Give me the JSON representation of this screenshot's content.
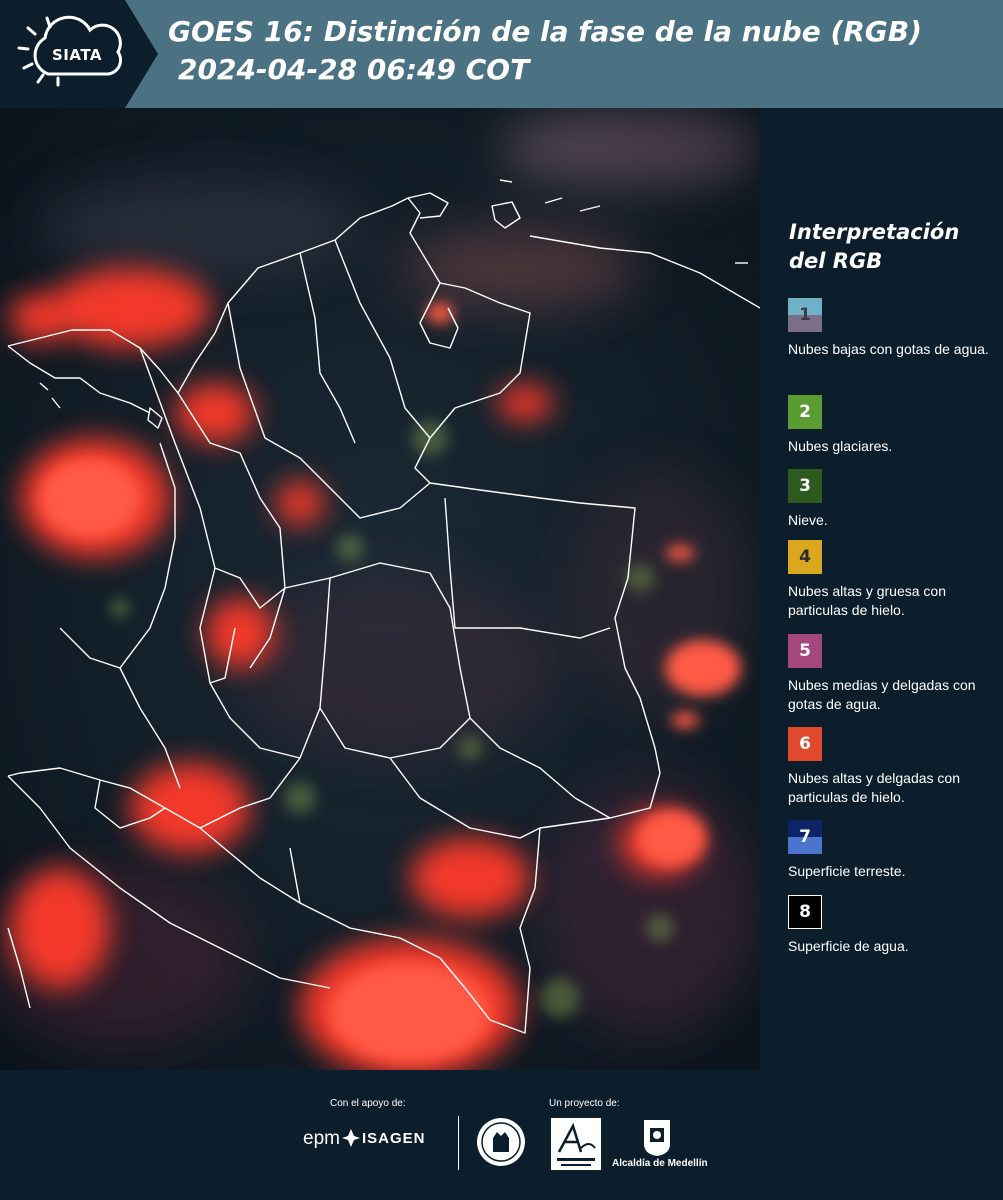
{
  "header": {
    "logo_text": "SIATA",
    "title": "GOES 16: Distinción de la fase de la nube (RGB)",
    "subtitle": "2024-04-28 06:49 COT"
  },
  "legend": {
    "title_line1": "Interpretación",
    "title_line2": "del RGB",
    "items": [
      {
        "number": "1",
        "label": "Nubes bajas con gotas de agua.",
        "color": "#6fb2c8/#7a6e8a"
      },
      {
        "number": "2",
        "label": "Nubes glaciares.",
        "color": "#5a9b32"
      },
      {
        "number": "3",
        "label": "Nieve.",
        "color": "#2d5a1f"
      },
      {
        "number": "4",
        "label": "Nubes altas y gruesa con particulas de hielo.",
        "color": "#d9a81e"
      },
      {
        "number": "5",
        "label": "Nubes medias y delgadas con gotas de agua.",
        "color": "#a4477e"
      },
      {
        "number": "6",
        "label": "Nubes altas y delgadas con particulas de hielo.",
        "color": "#e0492b"
      },
      {
        "number": "7",
        "label": "Superficie terreste.",
        "color": "#0f2468/#4c74cc"
      },
      {
        "number": "8",
        "label": "Superficie de agua.",
        "color": "#000000"
      }
    ]
  },
  "footer": {
    "support_label": "Con el apoyo de:",
    "project_label": "Un proyecto de:",
    "epm": "epm",
    "isagen": "ISAGEN",
    "alcaldia": "Alcaldía de Medellín"
  },
  "colors": {
    "header_bg": "#4a7283",
    "page_bg": "#0c1e2b",
    "cloud_red": "#ff3b2a"
  }
}
